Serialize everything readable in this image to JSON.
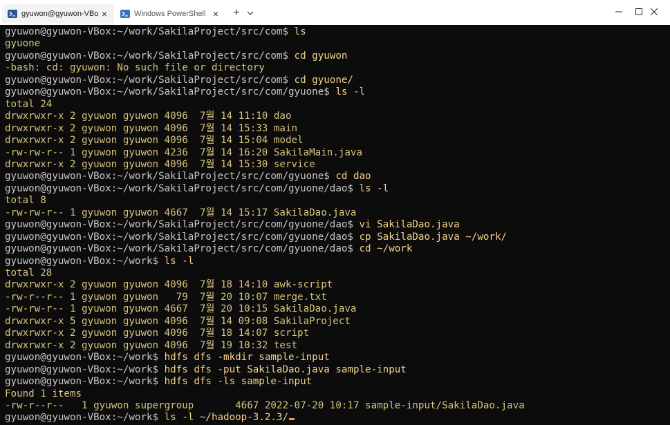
{
  "window": {
    "tabs": [
      {
        "label": "gyuwon@gyuwon-VBox: ~/v",
        "icon": "terminal-icon",
        "active": true
      },
      {
        "label": "Windows PowerShell",
        "icon": "powershell-icon",
        "active": false
      }
    ],
    "new_tab_label": "+",
    "dropdown_icon": "chevron-down-icon",
    "controls": {
      "minimize": "minimize-icon",
      "maximize": "maximize-icon",
      "close": "close-icon"
    }
  },
  "terminal": {
    "prompt_color": "#c8c8c8",
    "command_color": "#f6d38a",
    "output_color": "#d7c47f",
    "cursor_color": "#f0a030",
    "lines": [
      {
        "prompt": "gyuwon@gyuwon-VBox:~/work/SakilaProject/src/com$ ",
        "text": "ls"
      },
      {
        "prompt": "",
        "text": "gyuone"
      },
      {
        "prompt": "gyuwon@gyuwon-VBox:~/work/SakilaProject/src/com$ ",
        "text": "cd gyuwon"
      },
      {
        "prompt": "",
        "text": "-bash: cd: gyuwon: No such file or directory"
      },
      {
        "prompt": "gyuwon@gyuwon-VBox:~/work/SakilaProject/src/com$ ",
        "text": "cd gyuone/"
      },
      {
        "prompt": "gyuwon@gyuwon-VBox:~/work/SakilaProject/src/com/gyuone$ ",
        "text": "ls -l"
      },
      {
        "prompt": "",
        "text": "total 24"
      },
      {
        "prompt": "",
        "text": "drwxrwxr-x 2 gyuwon gyuwon 4096  7월 14 11:10 dao"
      },
      {
        "prompt": "",
        "text": "drwxrwxr-x 2 gyuwon gyuwon 4096  7월 14 15:33 main"
      },
      {
        "prompt": "",
        "text": "drwxrwxr-x 2 gyuwon gyuwon 4096  7월 14 15:04 model"
      },
      {
        "prompt": "",
        "text": "-rw-rw-r-- 1 gyuwon gyuwon 4236  7월 14 16:20 SakilaMain.java"
      },
      {
        "prompt": "",
        "text": "drwxrwxr-x 2 gyuwon gyuwon 4096  7월 14 15:30 service"
      },
      {
        "prompt": "gyuwon@gyuwon-VBox:~/work/SakilaProject/src/com/gyuone$ ",
        "text": "cd dao"
      },
      {
        "prompt": "gyuwon@gyuwon-VBox:~/work/SakilaProject/src/com/gyuone/dao$ ",
        "text": "ls -l"
      },
      {
        "prompt": "",
        "text": "total 8"
      },
      {
        "prompt": "",
        "text": "-rw-rw-r-- 1 gyuwon gyuwon 4667  7월 14 15:17 SakilaDao.java"
      },
      {
        "prompt": "gyuwon@gyuwon-VBox:~/work/SakilaProject/src/com/gyuone/dao$ ",
        "text": "vi SakilaDao.java"
      },
      {
        "prompt": "gyuwon@gyuwon-VBox:~/work/SakilaProject/src/com/gyuone/dao$ ",
        "text": "cp SakilaDao.java ~/work/"
      },
      {
        "prompt": "gyuwon@gyuwon-VBox:~/work/SakilaProject/src/com/gyuone/dao$ ",
        "text": "cd ~/work"
      },
      {
        "prompt": "gyuwon@gyuwon-VBox:~/work$ ",
        "text": "ls -l"
      },
      {
        "prompt": "",
        "text": "total 28"
      },
      {
        "prompt": "",
        "text": "drwxrwxr-x 2 gyuwon gyuwon 4096  7월 18 14:10 awk-script"
      },
      {
        "prompt": "",
        "text": "-rw-r--r-- 1 gyuwon gyuwon   79  7월 20 10:07 merge.txt"
      },
      {
        "prompt": "",
        "text": "-rw-rw-r-- 1 gyuwon gyuwon 4667  7월 20 10:15 SakilaDao.java"
      },
      {
        "prompt": "",
        "text": "drwxrwxr-x 5 gyuwon gyuwon 4096  7월 14 09:08 SakilaProject"
      },
      {
        "prompt": "",
        "text": "drwxrwxr-x 2 gyuwon gyuwon 4096  7월 18 14:07 script"
      },
      {
        "prompt": "",
        "text": "drwxrwxr-x 2 gyuwon gyuwon 4096  7월 19 10:32 test"
      },
      {
        "prompt": "gyuwon@gyuwon-VBox:~/work$ ",
        "text": "hdfs dfs -mkdir sample-input"
      },
      {
        "prompt": "gyuwon@gyuwon-VBox:~/work$ ",
        "text": "hdfs dfs -put SakilaDao.java sample-input"
      },
      {
        "prompt": "gyuwon@gyuwon-VBox:~/work$ ",
        "text": "hdfs dfs -ls sample-input"
      },
      {
        "prompt": "",
        "text": "Found 1 items"
      },
      {
        "prompt": "",
        "text": "-rw-r--r--   1 gyuwon supergroup       4667 2022-07-20 10:17 sample-input/SakilaDao.java"
      },
      {
        "prompt": "gyuwon@gyuwon-VBox:~/work$ ",
        "text": "ls -l ~/hadoop-3.2.3/"
      }
    ]
  }
}
